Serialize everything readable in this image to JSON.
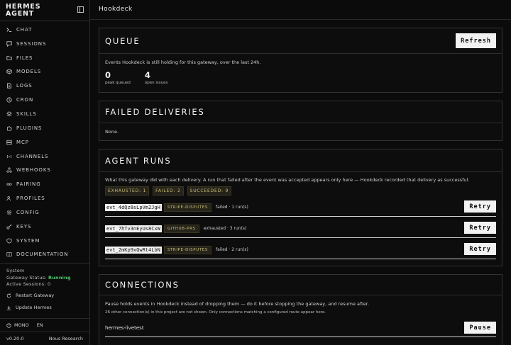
{
  "brand": {
    "line1": "HERMES",
    "line2": "AGENT"
  },
  "sidebar": {
    "items": [
      {
        "icon": "terminal-icon",
        "label": "CHAT"
      },
      {
        "icon": "chat-bubble-icon",
        "label": "SESSIONS"
      },
      {
        "icon": "folder-icon",
        "label": "FILES"
      },
      {
        "icon": "cube-icon",
        "label": "MODELS"
      },
      {
        "icon": "file-text-icon",
        "label": "LOGS"
      },
      {
        "icon": "clock-icon",
        "label": "CRON"
      },
      {
        "icon": "layers-icon",
        "label": "SKILLS"
      },
      {
        "icon": "puzzle-icon",
        "label": "PLUGINS"
      },
      {
        "icon": "server-icon",
        "label": "MCP"
      },
      {
        "icon": "radio-icon",
        "label": "CHANNELS"
      },
      {
        "icon": "webhook-icon",
        "label": "WEBHOOKS"
      },
      {
        "icon": "link-icon",
        "label": "PAIRING"
      },
      {
        "icon": "users-icon",
        "label": "PROFILES"
      },
      {
        "icon": "settings-icon",
        "label": "CONFIG"
      },
      {
        "icon": "key-icon",
        "label": "KEYS"
      },
      {
        "icon": "shield-icon",
        "label": "SYSTEM"
      },
      {
        "icon": "book-icon",
        "label": "DOCUMENTATION"
      }
    ],
    "system": {
      "heading": "System",
      "gateway_label": "Gateway Status:",
      "gateway_value": "Running",
      "sessions_label": "Active Sessions:",
      "sessions_value": "0",
      "restart_label": "Restart Gateway",
      "update_label": "Update Hermes"
    },
    "font_toggle": "MONO",
    "language": "EN",
    "version": "v0.20.0",
    "vendor": "Nous Research"
  },
  "topbar": {
    "title": "Hookdeck"
  },
  "queue": {
    "title": "QUEUE",
    "refresh_label": "Refresh",
    "description": "Events Hookdeck is still holding for this gateway, over the last 24h.",
    "stats": [
      {
        "value": "0",
        "label": "peak queued"
      },
      {
        "value": "4",
        "label": "open issues"
      }
    ]
  },
  "failed": {
    "title": "FAILED DELIVERIES",
    "body": "None."
  },
  "agent_runs": {
    "title": "AGENT RUNS",
    "description": "What this gateway did with each delivery. A run that failed after the event was accepted appears only here — Hookdeck recorded that delivery as successful.",
    "badges": [
      "EXHAUSTED: 1",
      "FAILED: 2",
      "SUCCEEDED: 9"
    ],
    "retry_label": "Retry",
    "runs": [
      {
        "event": "evt_4dQz8sLpVm2JgH",
        "source": "STRIPE-DISPUTES",
        "status": "failed · 1 run(s)"
      },
      {
        "event": "evt_7hTv3nEyUs8CxW",
        "source": "GITHUB-PRS",
        "status": "exhausted · 3 run(s)"
      },
      {
        "event": "evt_2mKp9xQwRt4LbN",
        "source": "STRIPE-DISPUTES",
        "status": "failed · 2 run(s)"
      }
    ]
  },
  "connections": {
    "title": "CONNECTIONS",
    "description": "Pause holds events in Hookdeck instead of dropping them — do it before stopping the gateway, and resume after.",
    "note": "26 other connection(s) in this project are not shown. Only connections matching a configured route appear here.",
    "items": [
      {
        "name": "hermes-livetest",
        "action": "Pause"
      }
    ]
  },
  "colors": {
    "background": "#0b0b0b",
    "accent_ok": "#4cc86a",
    "badge_text": "#cbbf7a",
    "button_bg": "#f2f2f2"
  }
}
